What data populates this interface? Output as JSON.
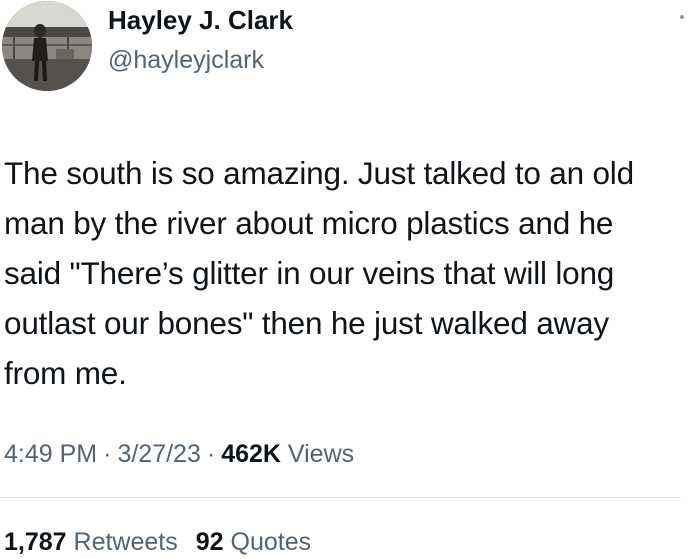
{
  "author": {
    "display_name": "Hayley J. Clark",
    "handle": "@hayleyjclark"
  },
  "tweet": {
    "text_lines": [
      "The south is so amazing. Just talked to an old",
      "man by the river about micro plastics and he",
      "said \"There’s glitter in our veins that will long",
      "outlast our bones\" then he just walked away",
      "from me."
    ],
    "time": "4:49 PM",
    "date": "3/27/23",
    "separator": "·",
    "views_count": "462K",
    "views_label": "Views"
  },
  "stats": {
    "retweets_count": "1,787",
    "retweets_label": "Retweets",
    "quotes_count": "92",
    "quotes_label": "Quotes"
  },
  "colors": {
    "text_primary": "#0f1419",
    "text_secondary": "#536471",
    "divider": "#e1e6ea"
  },
  "icons": {
    "avatar": "profile-photo",
    "more": "more-options-icon"
  }
}
